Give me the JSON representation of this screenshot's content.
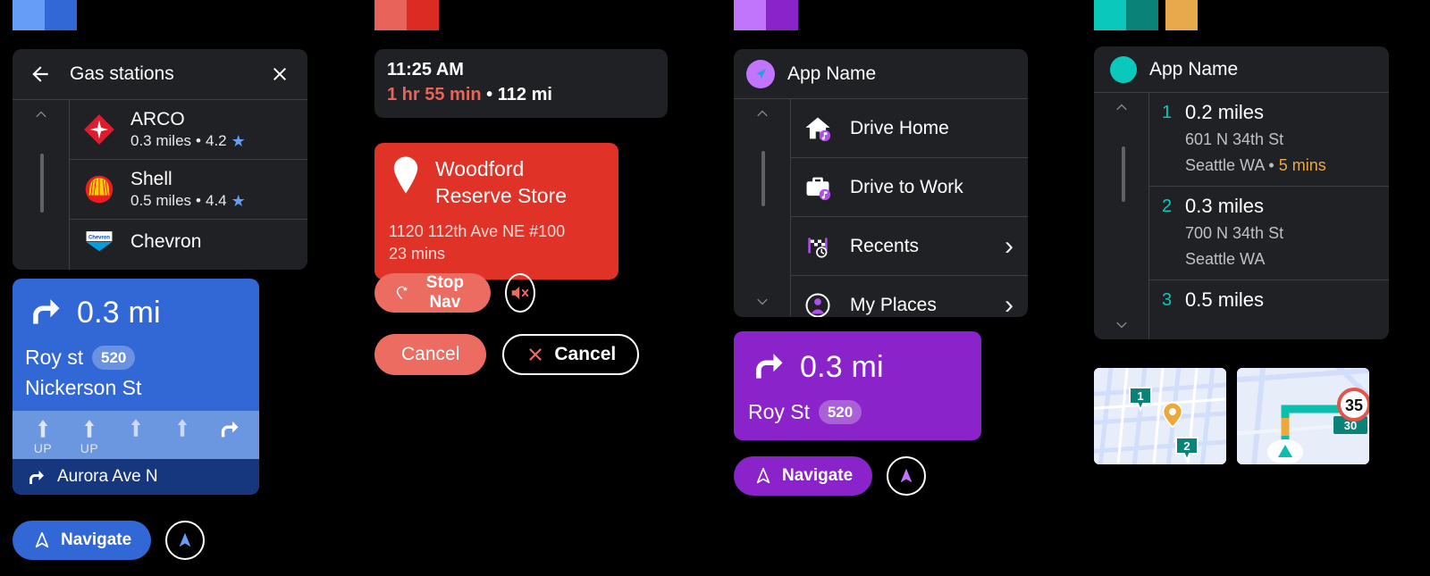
{
  "palettes": {
    "blue": {
      "light": "#669df6",
      "dark": "#3267d6"
    },
    "red": {
      "light": "#e8645a",
      "dark": "#db2b22"
    },
    "purple": {
      "light": "#c175fc",
      "dark": "#8a23c9"
    },
    "teal": {
      "light": "#0bc8bc",
      "dark": "#0b8278",
      "accent": "#e8a84c"
    }
  },
  "column_blue": {
    "gas_panel": {
      "back_icon": "back-arrow-icon",
      "title": "Gas stations",
      "close_icon": "close-icon",
      "scroll_up_icon": "chevron-up-icon",
      "items": [
        {
          "logo": "arco-logo",
          "name": "ARCO",
          "distance": "0.3 miles",
          "separator": "•",
          "rating": "4.2",
          "star": "★"
        },
        {
          "logo": "shell-logo",
          "name": "Shell",
          "distance": "0.5 miles",
          "separator": "•",
          "rating": "4.4",
          "star": "★"
        },
        {
          "logo": "chevron-logo",
          "name": "Chevron",
          "distance": "",
          "separator": "",
          "rating": "",
          "star": ""
        }
      ]
    },
    "nav_card": {
      "maneuver_icon": "turn-right-icon",
      "distance": "0.3 mi",
      "street": "Roy st",
      "route_shield": "520",
      "street2": "Nickerson St",
      "lanes": [
        {
          "icon": "arrow-up-icon",
          "label": "UP",
          "active": false
        },
        {
          "icon": "arrow-up-icon",
          "label": "UP",
          "active": false
        },
        {
          "icon": "arrow-up-icon",
          "label": "",
          "active": false
        },
        {
          "icon": "arrow-up-icon",
          "label": "",
          "active": false
        },
        {
          "icon": "turn-right-icon",
          "label": "",
          "active": true
        }
      ],
      "next_icon": "turn-right-icon",
      "next_street": "Aurora Ave N"
    },
    "actions": {
      "navigate_label": "Navigate",
      "navigate_icon": "navigation-arrow-icon",
      "compass_icon": "compass-arrow-icon"
    }
  },
  "column_red": {
    "eta_card": {
      "time": "11:25 AM",
      "duration": "1 hr 55 min",
      "separator": "•",
      "distance": "112 mi"
    },
    "dest_card": {
      "pin_icon": "map-pin-icon",
      "name_line1": "Woodford",
      "name_line2": "Reserve Store",
      "address": "1120 112th Ave NE #100",
      "eta": "23 mins"
    },
    "buttons": {
      "stop_nav_label": "Stop Nav",
      "stop_nav_icon": "stop-navigation-icon",
      "mute_icon": "mute-icon",
      "cancel_filled_label": "Cancel",
      "cancel_outline_label": "Cancel",
      "cancel_outline_icon": "close-icon"
    }
  },
  "column_purple": {
    "panel": {
      "app_icon": "navigation-arrow-icon",
      "title": "App Name",
      "scroll_up_icon": "chevron-up-icon",
      "scroll_down_icon": "chevron-down-icon",
      "items": [
        {
          "icon": "home-icon",
          "label": "Drive Home",
          "chevron": ""
        },
        {
          "icon": "briefcase-icon",
          "label": "Drive to Work",
          "chevron": ""
        },
        {
          "icon": "recents-flag-icon",
          "label": "Recents",
          "chevron": "›"
        },
        {
          "icon": "person-icon",
          "label": "My Places",
          "chevron": "›"
        }
      ]
    },
    "nav_card": {
      "maneuver_icon": "turn-right-icon",
      "distance": "0.3 mi",
      "street": "Roy St",
      "route_shield": "520"
    },
    "actions": {
      "navigate_label": "Navigate",
      "navigate_icon": "navigation-arrow-icon",
      "compass_icon": "compass-arrow-icon"
    }
  },
  "column_teal": {
    "panel": {
      "app_icon": "app-circle-icon",
      "title": "App Name",
      "scroll_up_icon": "chevron-up-icon",
      "scroll_down_icon": "chevron-down-icon",
      "steps": [
        {
          "num": "1",
          "distance": "0.2 miles",
          "line1": "601 N 34th St",
          "line2": "Seattle WA",
          "separator": "•",
          "eta": "5 mins"
        },
        {
          "num": "2",
          "distance": "0.3 miles",
          "line1": "700 N 34th St",
          "line2": "Seattle WA",
          "separator": "",
          "eta": ""
        },
        {
          "num": "3",
          "distance": "0.5 miles",
          "line1": "",
          "line2": "",
          "separator": "",
          "eta": ""
        }
      ]
    },
    "thumbnails": [
      {
        "name": "map-thumbnail-markers",
        "marker1": "1",
        "marker2": "2",
        "pin": "orange-pin-icon"
      },
      {
        "name": "map-thumbnail-route",
        "speed_limit": "35",
        "speed_badge": "30",
        "vehicle": "vehicle-arrow-icon"
      }
    ]
  }
}
